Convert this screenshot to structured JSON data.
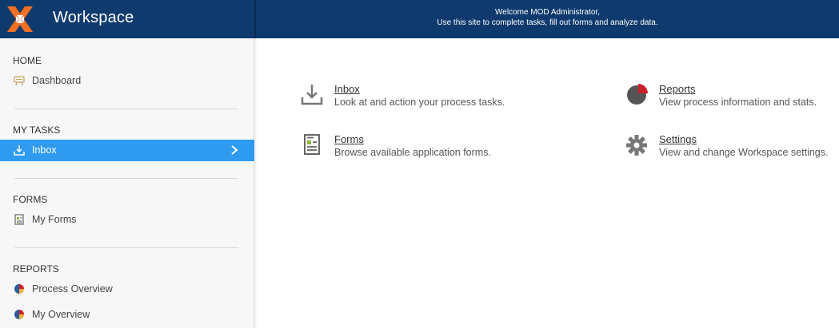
{
  "header": {
    "app_title": "Workspace",
    "welcome_line1": "Welcome MOD Administrator,",
    "welcome_line2": "Use this site to complete tasks, fill out forms and analyze data.",
    "bg_color": "#0e3a6e",
    "logo_colors": [
      "#f36f21",
      "#ffffff"
    ]
  },
  "sidebar": {
    "sections": [
      {
        "heading": "HOME",
        "items": [
          {
            "label": "Dashboard",
            "icon": "dashboard-icon"
          }
        ]
      },
      {
        "heading": "MY TASKS",
        "items": [
          {
            "label": "Inbox",
            "icon": "inbox-download-icon",
            "active": true
          }
        ]
      },
      {
        "heading": "FORMS",
        "items": [
          {
            "label": "My Forms",
            "icon": "form-document-icon"
          }
        ]
      },
      {
        "heading": "REPORTS",
        "items": [
          {
            "label": "Process Overview",
            "icon": "pie-chart-icon"
          },
          {
            "label": "My Overview",
            "icon": "pie-chart-icon"
          }
        ]
      }
    ],
    "active_color": "#2f9bf0"
  },
  "main": {
    "tiles": [
      {
        "title": "Inbox",
        "description": "Look at and action your process tasks.",
        "icon": "inbox-download-icon"
      },
      {
        "title": "Reports",
        "description": "View process information and stats.",
        "icon": "pie-chart-icon"
      },
      {
        "title": "Forms",
        "description": "Browse available application forms.",
        "icon": "form-document-icon"
      },
      {
        "title": "Settings",
        "description": "View and change Workspace settings.",
        "icon": "gear-icon"
      }
    ]
  }
}
